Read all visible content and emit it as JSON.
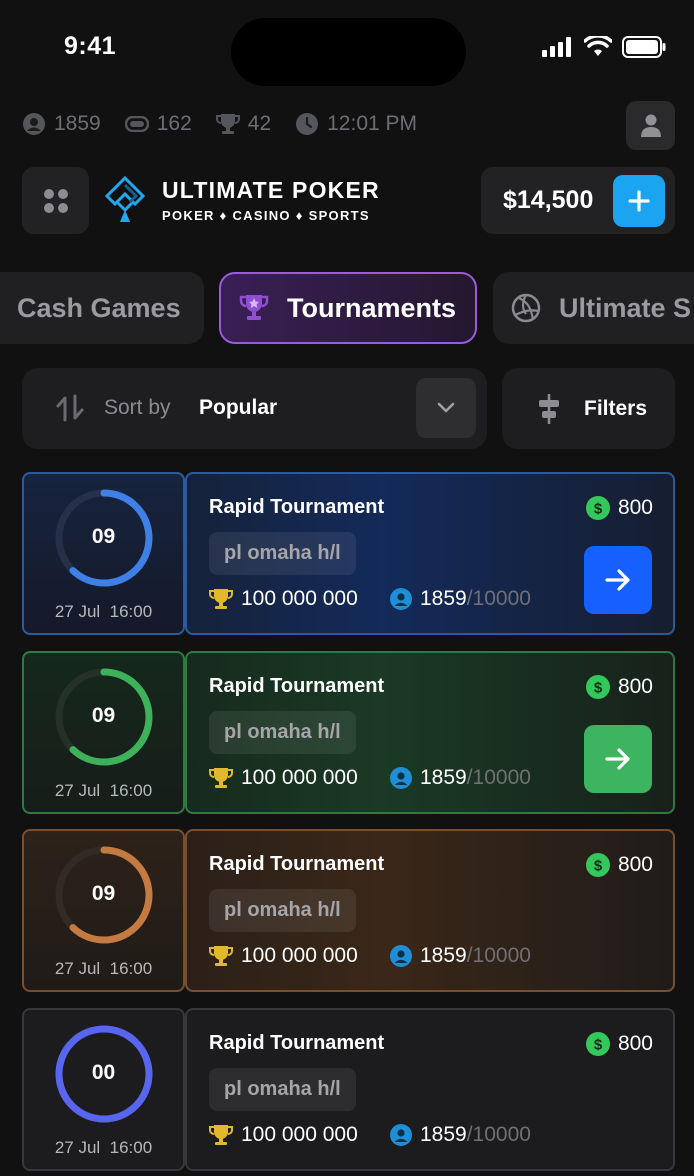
{
  "status_bar": {
    "time": "9:41"
  },
  "stats": [
    {
      "icon": "person-icon",
      "value": "1859"
    },
    {
      "icon": "chip-icon",
      "value": "162"
    },
    {
      "icon": "trophy-icon",
      "value": "42"
    },
    {
      "icon": "clock-icon",
      "value": "12:01 PM"
    }
  ],
  "logo": {
    "title": "ULTIMATE POKER",
    "subtitle": "POKER ♦ CASINO ♦ SPORTS"
  },
  "balance": {
    "amount": "$14,500"
  },
  "tabs": [
    {
      "label": "Cash Games",
      "active": false
    },
    {
      "label": "Tournaments",
      "active": true
    },
    {
      "label": "Ultimate S",
      "active": false
    }
  ],
  "sort": {
    "label": "Sort by",
    "value": "Popular"
  },
  "filters": {
    "label": "Filters"
  },
  "colors": {
    "blue": "#2f6fff",
    "green": "#3fb561",
    "orange": "#c97d3f",
    "indigo": "#5e6bf0"
  },
  "tournaments": [
    {
      "timer": "09",
      "progress": 0.62,
      "date": "27 Jul",
      "time": "16:00",
      "title": "Rapid Tournament",
      "game": "pl omaha h/l",
      "prize": "100 000 000",
      "players": "1859",
      "max_players": "/10000",
      "fee": "800",
      "theme": "blue",
      "has_button": true
    },
    {
      "timer": "09",
      "progress": 0.62,
      "date": "27 Jul",
      "time": "16:00",
      "title": "Rapid Tournament",
      "game": "pl omaha h/l",
      "prize": "100 000 000",
      "players": "1859",
      "max_players": "/10000",
      "fee": "800",
      "theme": "green",
      "has_button": true
    },
    {
      "timer": "09",
      "progress": 0.62,
      "date": "27 Jul",
      "time": "16:00",
      "title": "Rapid Tournament",
      "game": "pl omaha h/l",
      "prize": "100 000 000",
      "players": "1859",
      "max_players": "/10000",
      "fee": "800",
      "theme": "orange",
      "has_button": false
    },
    {
      "timer": "00",
      "progress": 1.0,
      "date": "27 Jul",
      "time": "16:00",
      "title": "Rapid Tournament",
      "game": "pl omaha h/l",
      "prize": "100 000 000",
      "players": "1859",
      "max_players": "/10000",
      "fee": "800",
      "theme": "indigo",
      "has_button": false
    }
  ]
}
